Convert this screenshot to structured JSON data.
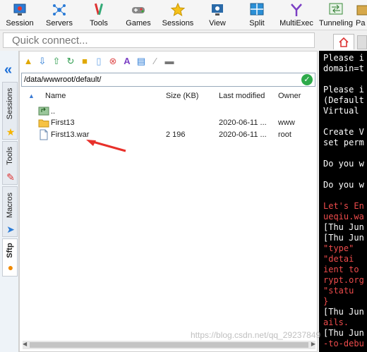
{
  "toolbar": {
    "items": [
      {
        "label": "Session",
        "icon": "session-icon"
      },
      {
        "label": "Servers",
        "icon": "servers-icon"
      },
      {
        "label": "Tools",
        "icon": "tools-icon"
      },
      {
        "label": "Games",
        "icon": "games-icon"
      },
      {
        "label": "Sessions",
        "icon": "sessions-star-icon"
      },
      {
        "label": "View",
        "icon": "view-icon"
      },
      {
        "label": "Split",
        "icon": "split-icon"
      },
      {
        "label": "MultiExec",
        "icon": "multiexec-icon"
      },
      {
        "label": "Tunneling",
        "icon": "tunneling-icon"
      },
      {
        "label": "Pa",
        "icon": "packages-icon"
      }
    ]
  },
  "quick_connect": {
    "placeholder": "Quick connect..."
  },
  "side_tabs": [
    "Sessions",
    "Tools",
    "Macros",
    "Sftp"
  ],
  "sftp": {
    "path": "/data/wwwroot/default/",
    "columns": {
      "name": "Name",
      "size": "Size (KB)",
      "modified": "Last modified",
      "owner": "Owner"
    },
    "rows": [
      {
        "name": "..",
        "size": "",
        "modified": "",
        "owner": "",
        "kind": "parent"
      },
      {
        "name": "First13",
        "size": "",
        "modified": "2020-06-11 ...",
        "owner": "www",
        "kind": "folder"
      },
      {
        "name": "First13.war",
        "size": "2 196",
        "modified": "2020-06-11 ...",
        "owner": "root",
        "kind": "file"
      }
    ]
  },
  "terminal": {
    "lines": [
      {
        "text": "Please i",
        "color": "#ffffff"
      },
      {
        "text": "domain=t",
        "color": "#ffffff"
      },
      {
        "text": "",
        "color": "#ffffff"
      },
      {
        "text": "Please i",
        "color": "#ffffff"
      },
      {
        "text": "(Default",
        "color": "#ffffff"
      },
      {
        "text": "Virtual ",
        "color": "#ffffff"
      },
      {
        "text": "",
        "color": "#ffffff"
      },
      {
        "text": "Create V",
        "color": "#ffffff"
      },
      {
        "text": "set perm",
        "color": "#ffffff"
      },
      {
        "text": "",
        "color": "#ffffff"
      },
      {
        "text": "Do you w",
        "color": "#ffffff"
      },
      {
        "text": "",
        "color": "#ffffff"
      },
      {
        "text": "Do you w",
        "color": "#ffffff"
      },
      {
        "text": "",
        "color": "#ffffff"
      },
      {
        "text": "Let's En",
        "color": "#ee4b4b"
      },
      {
        "text": "ueqiu.wa",
        "color": "#ee4b4b"
      },
      {
        "text": "[Thu Jun",
        "color": "#ffffff"
      },
      {
        "text": "[Thu Jun",
        "color": "#ffffff"
      },
      {
        "text": "  \"type\"",
        "color": "#ee4b4b"
      },
      {
        "text": "  \"detai",
        "color": "#ee4b4b"
      },
      {
        "text": "ient to ",
        "color": "#ee4b4b"
      },
      {
        "text": "rypt.org",
        "color": "#ee4b4b"
      },
      {
        "text": "  \"statu",
        "color": "#ee4b4b"
      },
      {
        "text": "}",
        "color": "#ee4b4b"
      },
      {
        "text": "[Thu Jun",
        "color": "#ffffff"
      },
      {
        "text": "ails.",
        "color": "#ee4b4b"
      },
      {
        "text": "[Thu Jun",
        "color": "#ffffff"
      },
      {
        "text": "-to-debu",
        "color": "#ee4b4b"
      }
    ]
  },
  "watermark": "https://blog.csdn.net/qq_29237849"
}
